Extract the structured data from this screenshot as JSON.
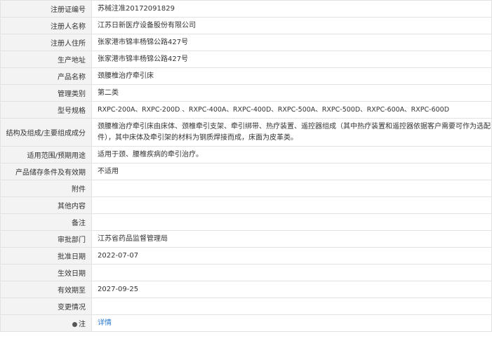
{
  "rows": [
    {
      "label": "注册证编号",
      "value": "苏械注准20172091829"
    },
    {
      "label": "注册人名称",
      "value": "江苏日新医疗设备股份有限公司"
    },
    {
      "label": "注册人住所",
      "value": "张家港市锦丰杨锦公路427号"
    },
    {
      "label": "生产地址",
      "value": "张家港市锦丰杨锦公路427号"
    },
    {
      "label": "产品名称",
      "value": "颈腰椎治疗牵引床"
    },
    {
      "label": "管理类别",
      "value": "第二类"
    },
    {
      "label": "型号规格",
      "value": "RXPC-200A、RXPC-200D 、RXPC-400A、RXPC-400D、RXPC-500A、RXPC-500D、RXPC-600A、RXPC-600D"
    },
    {
      "label": "结构及组成/主要组成成分",
      "value": "颈腰椎治疗牵引床由床体、颈椎牵引支架、牵引绑带、热疗装置、遥控器组成（其中热疗装置和遥控器依据客户需要可作为选配件），其中床体及牵引架的材料为钢质焊接而成，床面为皮革类。"
    },
    {
      "label": "适用范围/预期用途",
      "value": "适用于颈、腰椎疾病的牵引治疗。"
    },
    {
      "label": "产品储存条件及有效期",
      "value": "不适用"
    },
    {
      "label": "附件",
      "value": ""
    },
    {
      "label": "其他内容",
      "value": ""
    },
    {
      "label": "备注",
      "value": ""
    },
    {
      "label": "审批部门",
      "value": "江苏省药品监督管理局"
    },
    {
      "label": "批准日期",
      "value": "2022-07-07"
    },
    {
      "label": "生效日期",
      "value": ""
    },
    {
      "label": "有效期至",
      "value": "2027-09-25"
    },
    {
      "label": "变更情况",
      "value": ""
    }
  ],
  "note": {
    "label": "注",
    "link": "详情",
    "icon": "location-pin-icon"
  }
}
